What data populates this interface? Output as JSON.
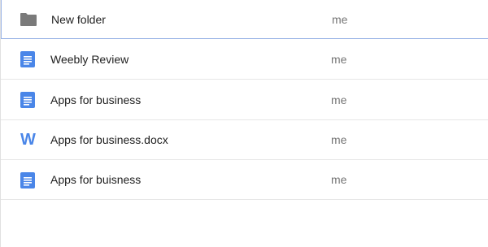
{
  "files": [
    {
      "name": "New folder",
      "owner": "me",
      "icon": "folder-icon",
      "color": "#7a7a7a"
    },
    {
      "name": "Weebly Review",
      "owner": "me",
      "icon": "google-doc-icon",
      "color": "#4a86e8"
    },
    {
      "name": "Apps for business",
      "owner": "me",
      "icon": "google-doc-icon",
      "color": "#4a86e8"
    },
    {
      "name": "Apps for business.docx",
      "owner": "me",
      "icon": "word-doc-icon",
      "color": "#4a86e8",
      "glyph": "W"
    },
    {
      "name": "Apps for buisness",
      "owner": "me",
      "icon": "google-doc-icon",
      "color": "#4a86e8"
    }
  ],
  "colors": {
    "accent": "#4a86e8",
    "selection_border": "#9ab4e6",
    "divider": "#e6e6e6"
  }
}
